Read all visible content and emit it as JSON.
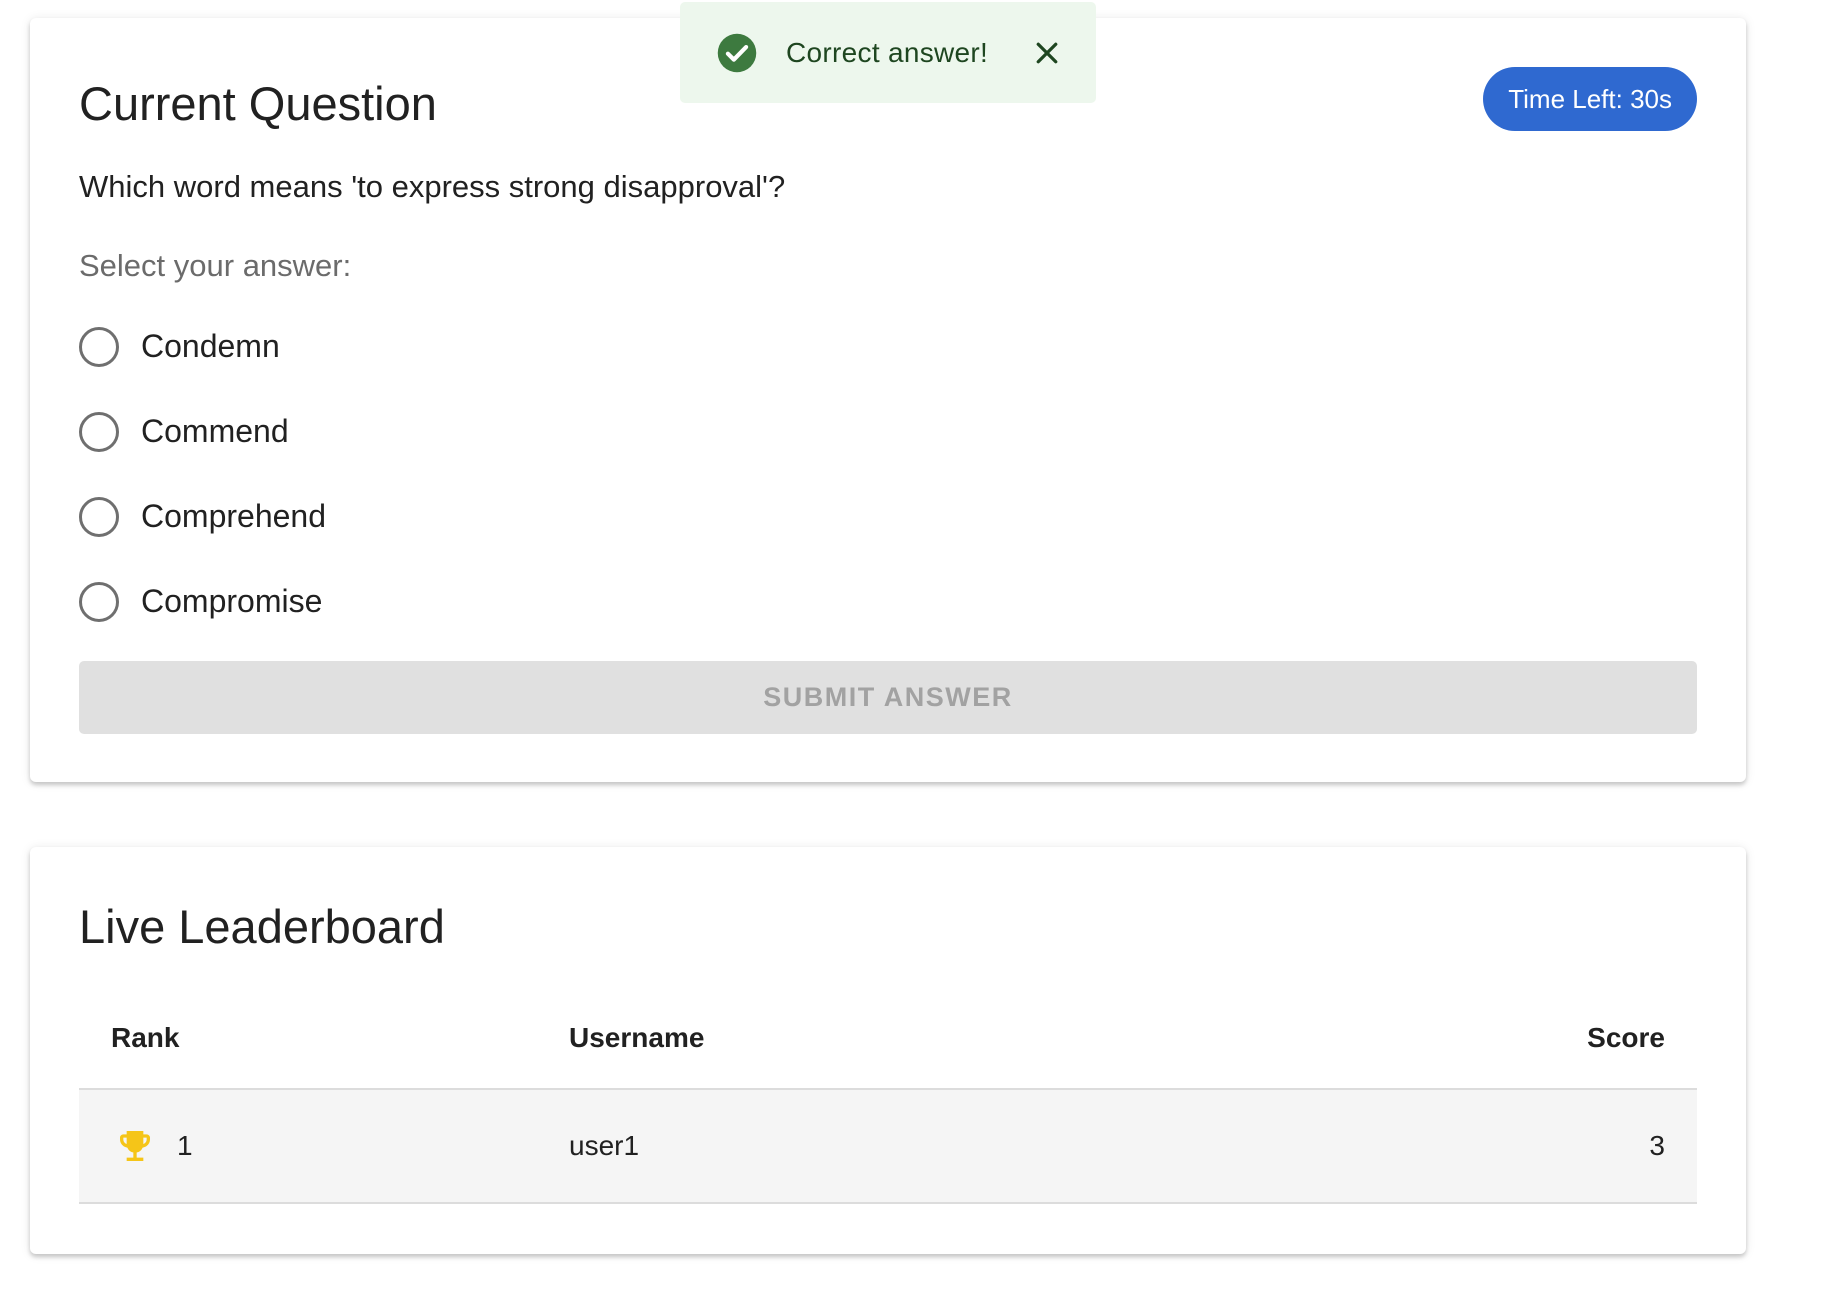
{
  "question_card": {
    "title": "Current Question",
    "timer": "Time Left: 30s",
    "question": "Which word means 'to express strong disapproval'?",
    "select_label": "Select your answer:",
    "options": [
      "Condemn",
      "Commend",
      "Comprehend",
      "Compromise"
    ],
    "submit_label": "SUBMIT ANSWER"
  },
  "leaderboard": {
    "title": "Live Leaderboard",
    "columns": {
      "rank": "Rank",
      "username": "Username",
      "score": "Score"
    },
    "rows": [
      {
        "rank": "1",
        "username": "user1",
        "score": "3",
        "icon": "trophy-icon"
      }
    ]
  },
  "toast": {
    "message": "Correct answer!",
    "icon": "check-circle-icon",
    "close_icon": "close-icon"
  },
  "colors": {
    "timer_chip": "#2f69d0",
    "success_green": "#2e7d32",
    "toast_background": "#edf7ed",
    "trophy_gold": "#f5c518",
    "submit_disabled": "#e0e0e0"
  }
}
